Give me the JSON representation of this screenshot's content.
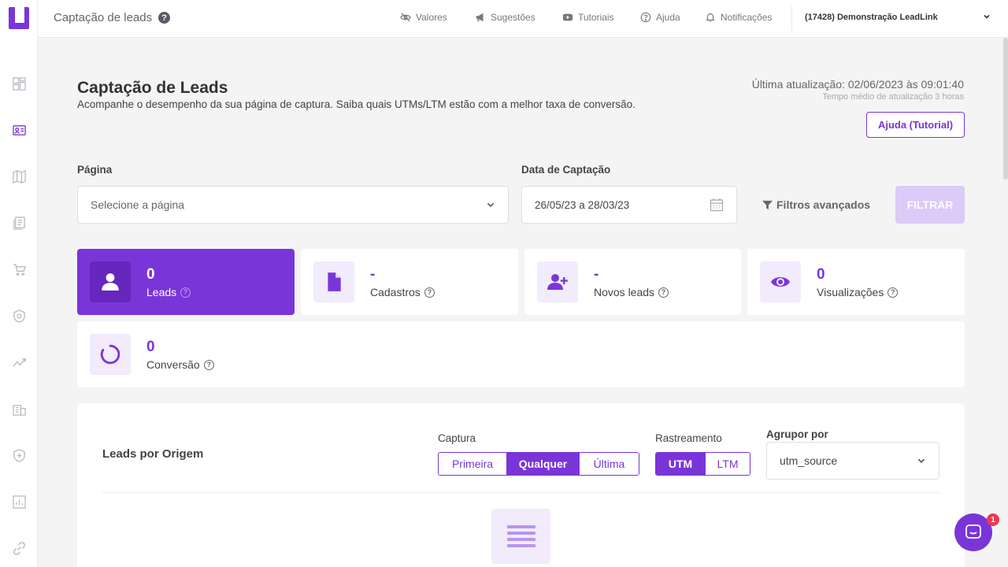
{
  "app": {
    "brand_color": "#7a35d8"
  },
  "topbar": {
    "title": "Captação de leads",
    "nav": [
      {
        "label": "Valores",
        "icon": "eye-off-icon"
      },
      {
        "label": "Sugestões",
        "icon": "megaphone-icon"
      },
      {
        "label": "Tutoriais",
        "icon": "youtube-icon"
      },
      {
        "label": "Ajuda",
        "icon": "help-circle-icon"
      },
      {
        "label": "Notificações",
        "icon": "bell-icon"
      }
    ],
    "account": "(17428) Demonstração LeadLink"
  },
  "sidebar": {
    "items": [
      "dashboard-icon",
      "lead-card-icon",
      "map-icon",
      "pages-icon",
      "cart-icon",
      "shield-icon",
      "trend-icon",
      "building-icon",
      "shield-plus-icon",
      "chart-icon",
      "link-icon"
    ]
  },
  "header": {
    "title": "Captação de Leads",
    "subtitle": "Acompanhe o desempenho da sua página de captura. Saiba quais UTMs/LTM estão com a melhor taxa de conversão.",
    "last_update": "Última atualização: 02/06/2023 às 09:01:40",
    "avg_update": "Tempo médio de atualização 3 horas",
    "help_button": "Ajuda (Tutorial)"
  },
  "filters": {
    "page_label": "Página",
    "page_placeholder": "Selecione a página",
    "date_label": "Data de Captação",
    "date_value": "26/05/23 a 28/03/23",
    "advanced": "Filtros avançados",
    "filter_button": "FILTRAR"
  },
  "stats": [
    {
      "value": "0",
      "label": "Leads",
      "active": true
    },
    {
      "value": "-",
      "label": "Cadastros"
    },
    {
      "value": "-",
      "label": "Novos leads"
    },
    {
      "value": "0",
      "label": "Visualizações"
    },
    {
      "value": "0",
      "label": "Conversão"
    }
  ],
  "origin": {
    "title": "Leads por Origem",
    "capture_label": "Captura",
    "capture_options": [
      "Primeira",
      "Qualquer",
      "Última"
    ],
    "capture_selected": "Qualquer",
    "tracking_label": "Rastreamento",
    "tracking_options": [
      "UTM",
      "LTM"
    ],
    "tracking_selected": "UTM",
    "group_label": "Agrupor por",
    "group_value": "utm_source"
  },
  "chat": {
    "badge": "1"
  }
}
